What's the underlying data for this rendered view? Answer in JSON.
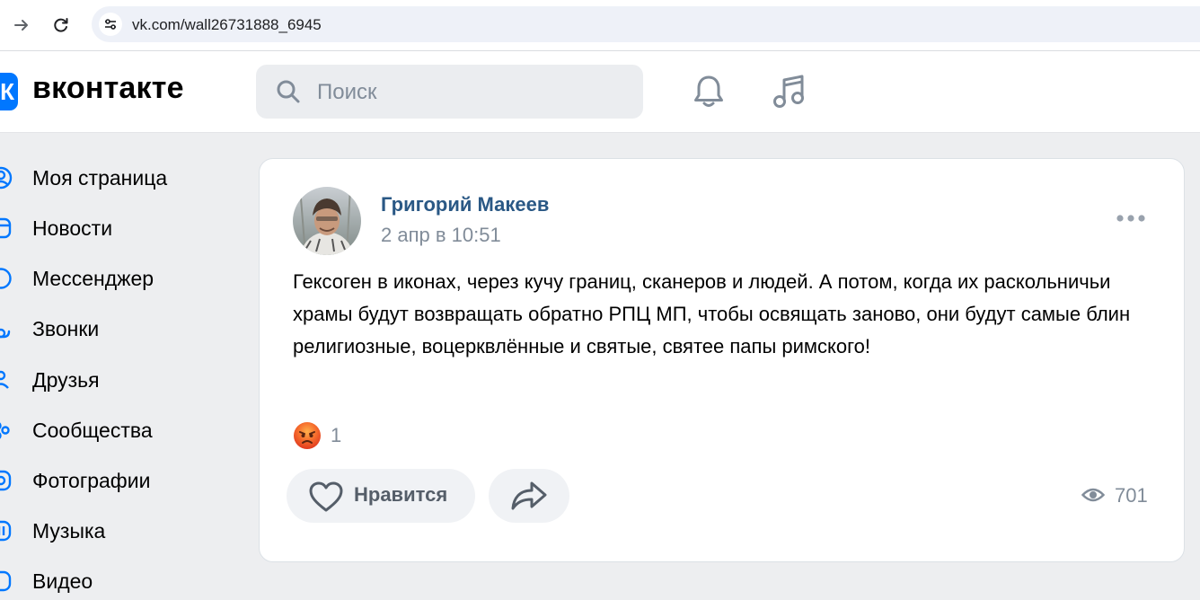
{
  "browser": {
    "url": "vk.com/wall26731888_6945",
    "icons": [
      "arrow-forward-icon",
      "reload-icon",
      "site-info-icon"
    ]
  },
  "header": {
    "logo_text": "вконтакте",
    "logo_mark": "К",
    "search_placeholder": "Поиск",
    "brand_color": "#0077ff",
    "icons": [
      "search-icon",
      "bell-icon",
      "music-icon"
    ]
  },
  "sidebar": {
    "items": [
      {
        "label": "Моя страница",
        "icon": "user-icon"
      },
      {
        "label": "Новости",
        "icon": "news-icon"
      },
      {
        "label": "Мессенджер",
        "icon": "message-icon"
      },
      {
        "label": "Звонки",
        "icon": "phone-icon"
      },
      {
        "label": "Друзья",
        "icon": "friends-icon"
      },
      {
        "label": "Сообщества",
        "icon": "communities-icon"
      },
      {
        "label": "Фотографии",
        "icon": "photo-icon"
      },
      {
        "label": "Музыка",
        "icon": "music-icon"
      },
      {
        "label": "Видео",
        "icon": "video-icon"
      }
    ]
  },
  "post": {
    "author": "Григорий Макеев",
    "date": "2 апр в 10:51",
    "text": "Гексоген в иконах, через кучу границ, сканеров и людей. А потом, когда их раскольничьи храмы будут возвращать обратно РПЦ МП, чтобы освящать заново, они будут самые блин религиозные, воцерквлённые и святые, святее папы римского!",
    "reaction_icon": "angry-face-icon",
    "reaction_count": "1",
    "like_label": "Нравится",
    "views": "701",
    "author_color": "#2a5885",
    "muted_color": "#818c99"
  }
}
